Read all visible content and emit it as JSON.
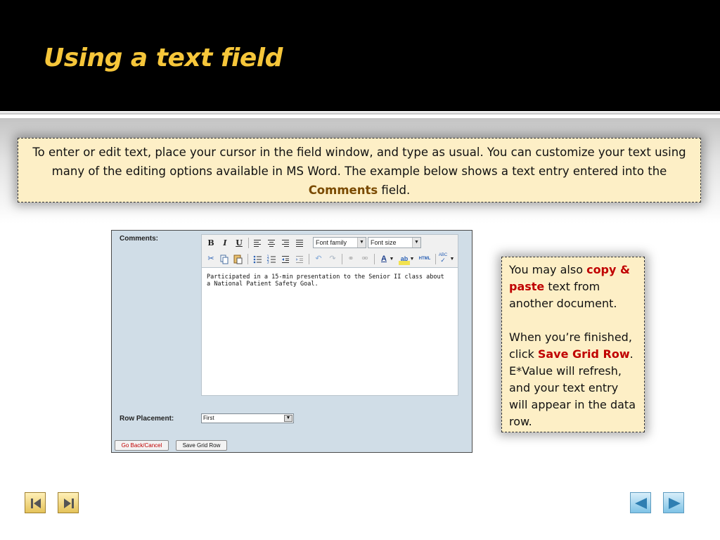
{
  "slide": {
    "title": "Using a text field",
    "intro": {
      "text_before": "To enter or edit text, place your cursor in the field window, and type as usual.  You can customize your text using many of the editing options available in MS Word.   The example below shows a text entry entered into the ",
      "highlight": "Comments",
      "text_after": " field."
    },
    "side_note": {
      "p1_before": "You may also ",
      "p1_highlight": "copy & paste",
      "p1_after": " text from another document.",
      "p2_before": "When you’re finished, click ",
      "p2_highlight": "Save Grid Row",
      "p2_after": ". E*Value will refresh, and your text entry will appear in the data row."
    }
  },
  "form": {
    "comments_label": "Comments:",
    "toolbar": {
      "bold": "B",
      "italic": "I",
      "underline": "U",
      "font_family": "Font family",
      "font_size": "Font size",
      "html": "HTML",
      "spellcheck": "ABC"
    },
    "editor_text": "Participated in a 15-min presentation to the Senior II class about a National Patient Safety Goal.",
    "row_placement_label": "Row Placement:",
    "row_placement_value": "First",
    "back_button": "Go Back/Cancel",
    "save_button": "Save Grid Row"
  },
  "icons": [
    "first-slide-icon",
    "last-slide-icon",
    "previous-slide-icon",
    "next-slide-icon"
  ],
  "colors": {
    "header_bg": "#000000",
    "title": "#f6c63a",
    "callout_bg": "#fdefc6",
    "highlight_brown": "#7a4a00",
    "highlight_red": "#c00000",
    "panel_bg": "#d0dde7"
  }
}
